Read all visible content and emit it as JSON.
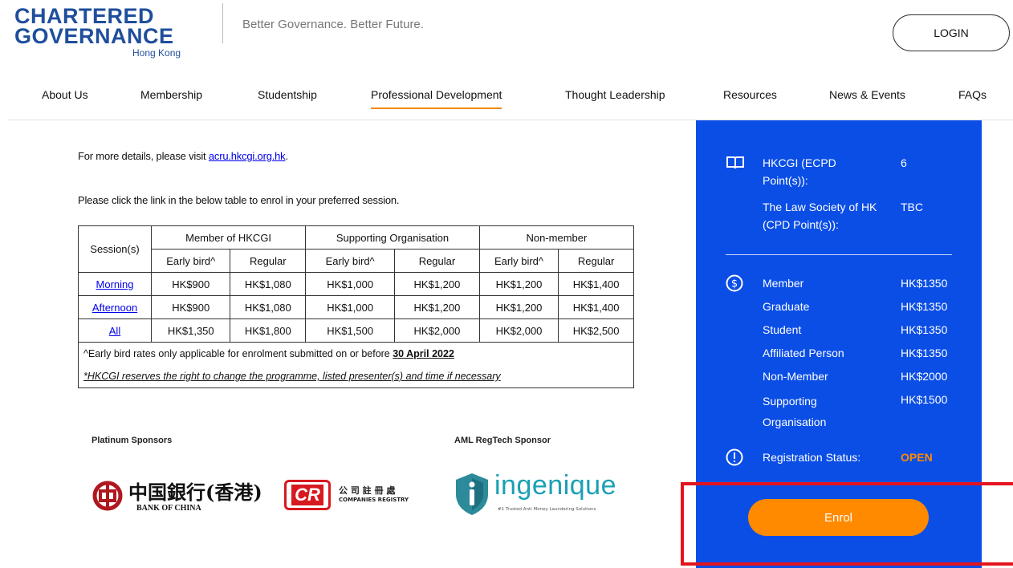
{
  "header": {
    "logo_line1": "CHARTERED",
    "logo_line2": "GOVERNANCE",
    "logo_line3": "Hong Kong",
    "tagline": "Better Governance. Better Future.",
    "login_label": "LOGIN"
  },
  "nav": {
    "items": [
      "About Us",
      "Membership",
      "Studentship",
      "Professional Development",
      "Thought Leadership",
      "Resources",
      "News & Events",
      "FAQs"
    ],
    "active": "Professional Development"
  },
  "content": {
    "details_prefix": "For more details, please visit ",
    "details_link": "acru.hkcgi.org.hk",
    "details_suffix": ".",
    "enrol_instruction": "Please click the link in the below table to enrol in your preferred session.",
    "table": {
      "header_session": "Session(s)",
      "groups": [
        "Member of HKCGI",
        "Supporting Organisation",
        "Non-member"
      ],
      "subheaders": [
        "Early bird^",
        "Regular",
        "Early bird^",
        "Regular",
        "Early bird^",
        "Regular"
      ],
      "rows": [
        {
          "session": "Morning",
          "fees": [
            "HK$900",
            "HK$1,080",
            "HK$1,000",
            "HK$1,200",
            "HK$1,200",
            "HK$1,400"
          ]
        },
        {
          "session": "Afternoon",
          "fees": [
            "HK$900",
            "HK$1,080",
            "HK$1,000",
            "HK$1,200",
            "HK$1,200",
            "HK$1,400"
          ]
        },
        {
          "session": "All",
          "fees": [
            "HK$1,350",
            "HK$1,800",
            "HK$1,500",
            "HK$2,000",
            "HK$2,000",
            "HK$2,500"
          ]
        }
      ],
      "note1_prefix": "^Early bird rates only applicable for enrolment submitted on or before ",
      "note1_date": "30 April 2022",
      "note2": "*HKCGI reserves the right to change the programme, listed presenter(s) and time if necessary"
    },
    "sponsors": {
      "platinum_label": "Platinum Sponsors",
      "aml_label": "AML RegTech Sponsor",
      "boc_chinese": "中国銀行(香港)",
      "boc_english": "BANK OF CHINA",
      "cr_letters": "CR",
      "cr_chinese": "公 司 註 冊 處",
      "cr_english": "COMPANIES REGISTRY",
      "ingenique_name": "ingenique",
      "ingenique_tagline": "#1 Trusted Anti Money Laundering Solutions"
    }
  },
  "panel": {
    "cpd": [
      {
        "label": "HKCGI (ECPD Point(s)):",
        "value": "6"
      },
      {
        "label": "The Law Society of HK (CPD Point(s)):",
        "value": "TBC"
      }
    ],
    "fees": [
      {
        "label": "Member",
        "value": "HK$1350"
      },
      {
        "label": "Graduate",
        "value": "HK$1350"
      },
      {
        "label": "Student",
        "value": "HK$1350"
      },
      {
        "label": "Affiliated Person",
        "value": "HK$1350"
      },
      {
        "label": "Non-Member",
        "value": "HK$2000"
      },
      {
        "label": "Supporting Organisation",
        "value": "HK$1500"
      }
    ],
    "status_label": "Registration Status:",
    "status_value": "OPEN",
    "enrol_label": "Enrol"
  },
  "colors": {
    "panel_blue": "#0b4ee6",
    "accent_orange": "#ff8a00",
    "logo_blue": "#1f4e9c",
    "highlight_red": "#e3141d"
  }
}
